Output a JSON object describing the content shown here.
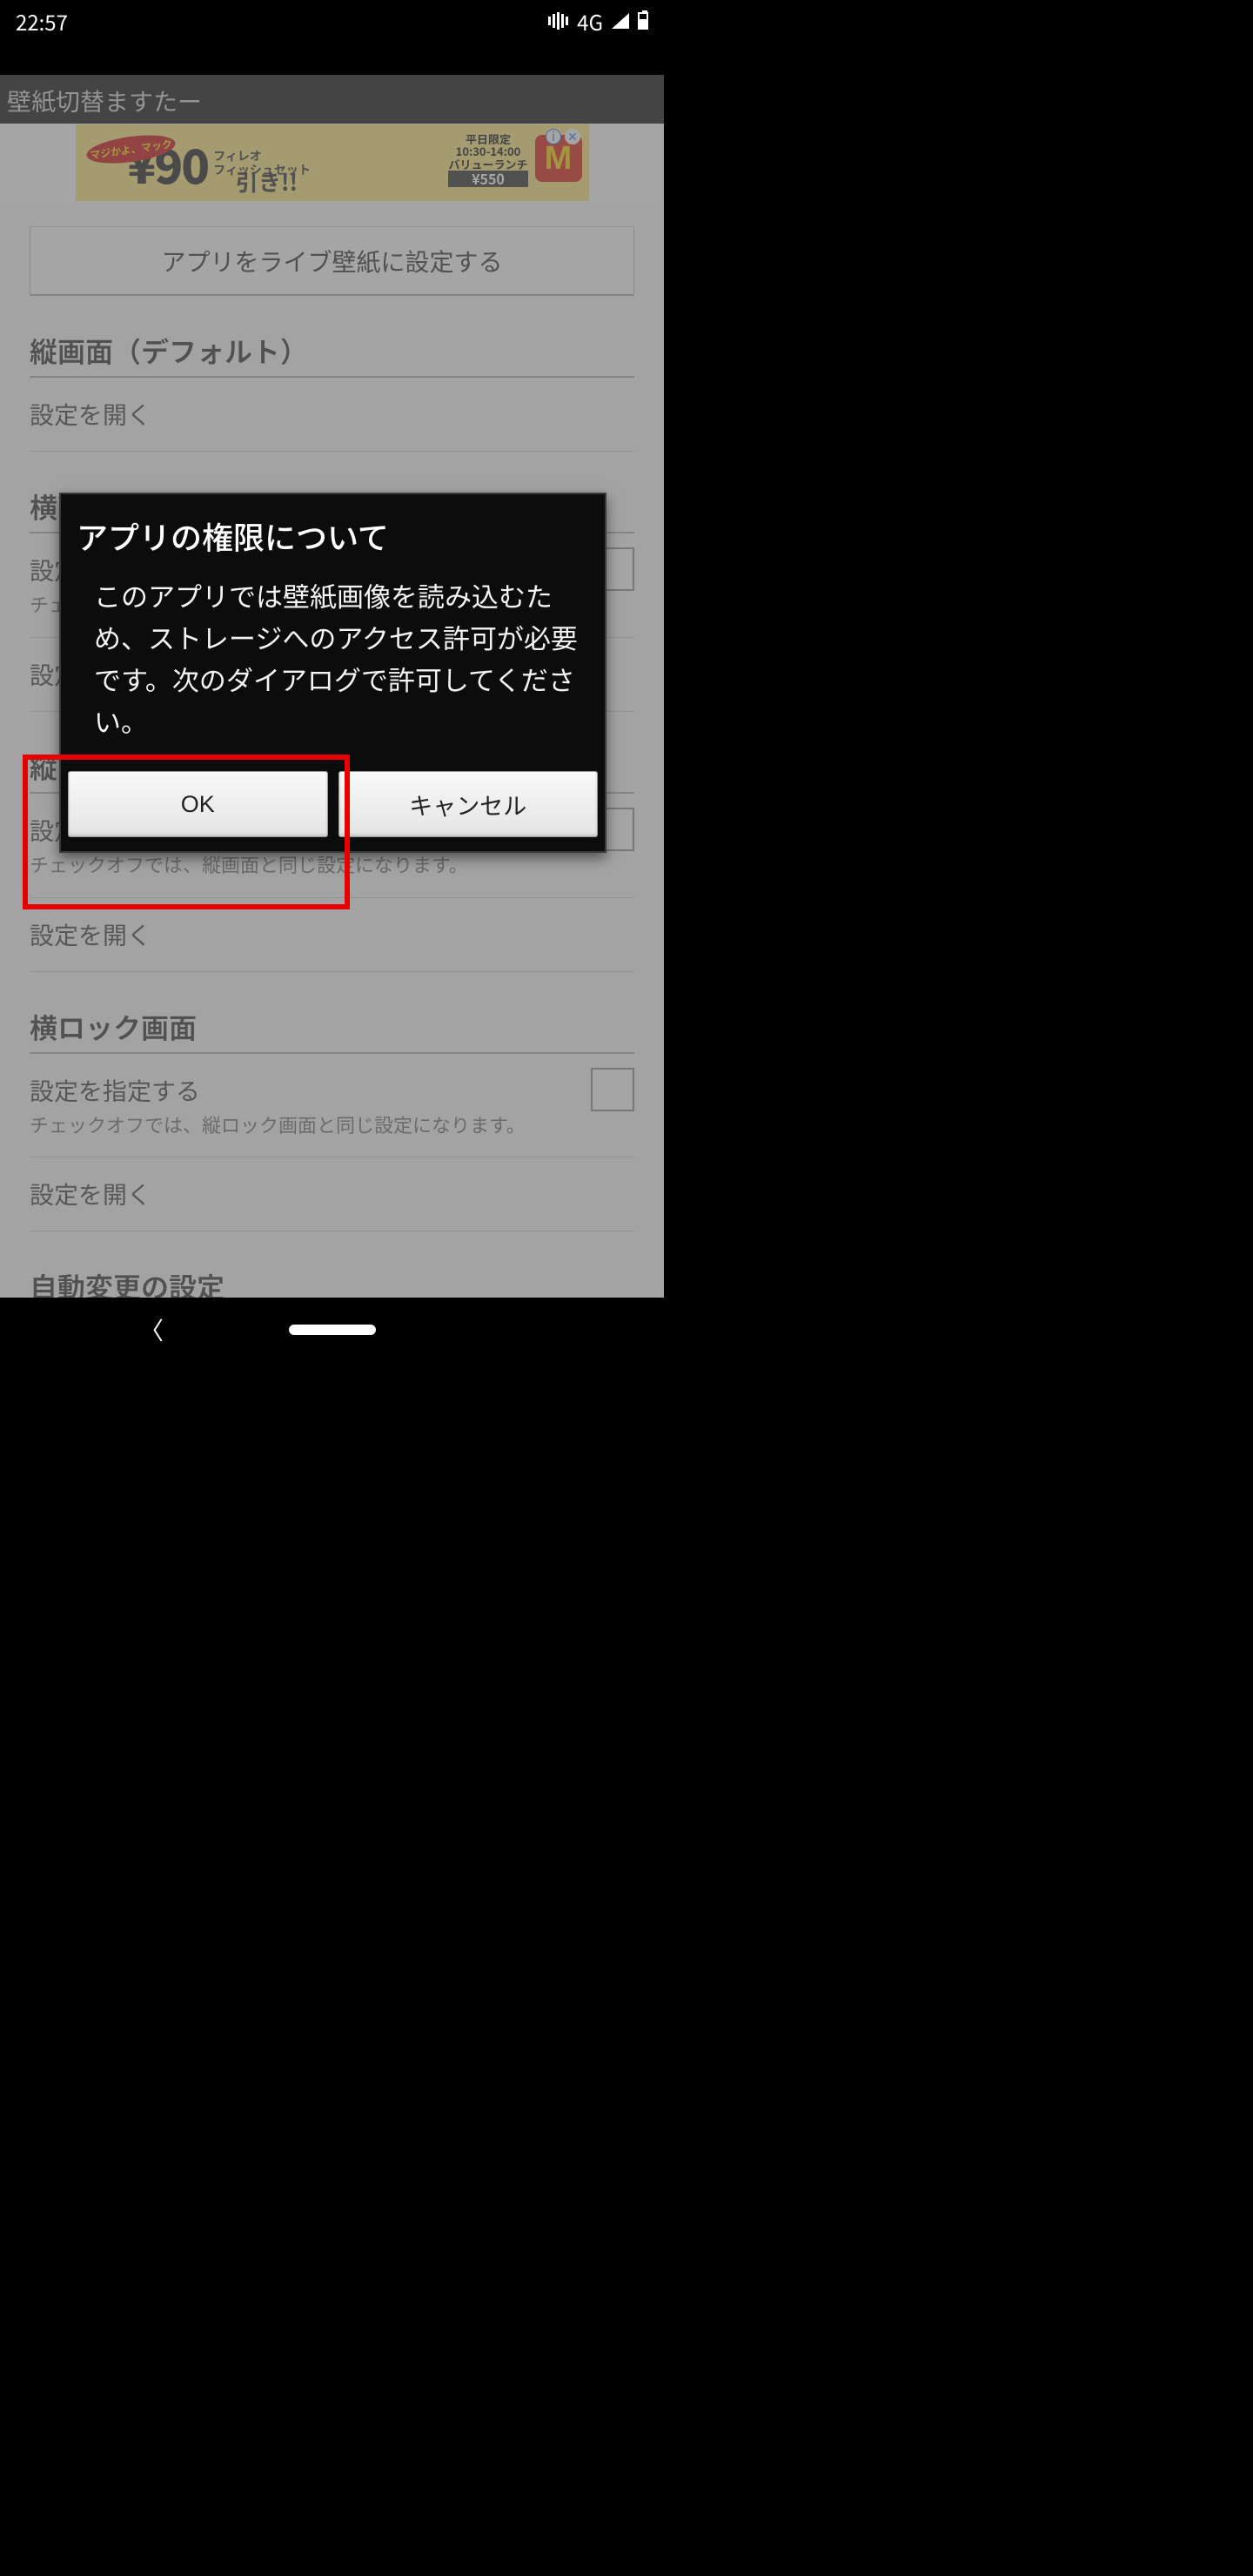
{
  "status": {
    "time": "22:57",
    "network": "4G"
  },
  "appbar": {
    "title": "壁紙切替ますたー"
  },
  "ad": {
    "badge": "マジかよ、マック",
    "big_price": "¥90",
    "hiki": "引き!!",
    "combo_lines": "フィレオ\nフィッシュセット",
    "right_lines_1": "平日限定",
    "right_lines_2": "10:30-14:00",
    "right_lines_3": "バリューランチ",
    "right_price": "¥550",
    "mcd": "M",
    "info": "i",
    "close": "✕"
  },
  "main": {
    "set_live_btn": "アプリをライブ壁紙に設定する",
    "section_portrait": "縦画面（デフォルト）",
    "open_settings": "設定を開く",
    "section_landscape": "横画面",
    "specify_settings": "設定を指定する",
    "landscape_sub": "チェックオフでは、縦画面と同じ設定になります。",
    "section_portrait_lock": "縦ロック画面",
    "portrait_lock_sub": "チェックオフでは、縦画面と同じ設定になります。",
    "section_landscape_lock": "横ロック画面",
    "landscape_lock_sub": "チェックオフでは、縦ロック画面と同じ設定になります。",
    "section_auto": "自動変更の設定"
  },
  "dialog": {
    "title": "アプリの権限について",
    "body": "このアプリでは壁紙画像を読み込むため、ストレージへのアクセス許可が必要です。次のダイアログで許可してください。",
    "ok": "OK",
    "cancel": "キャンセル"
  }
}
